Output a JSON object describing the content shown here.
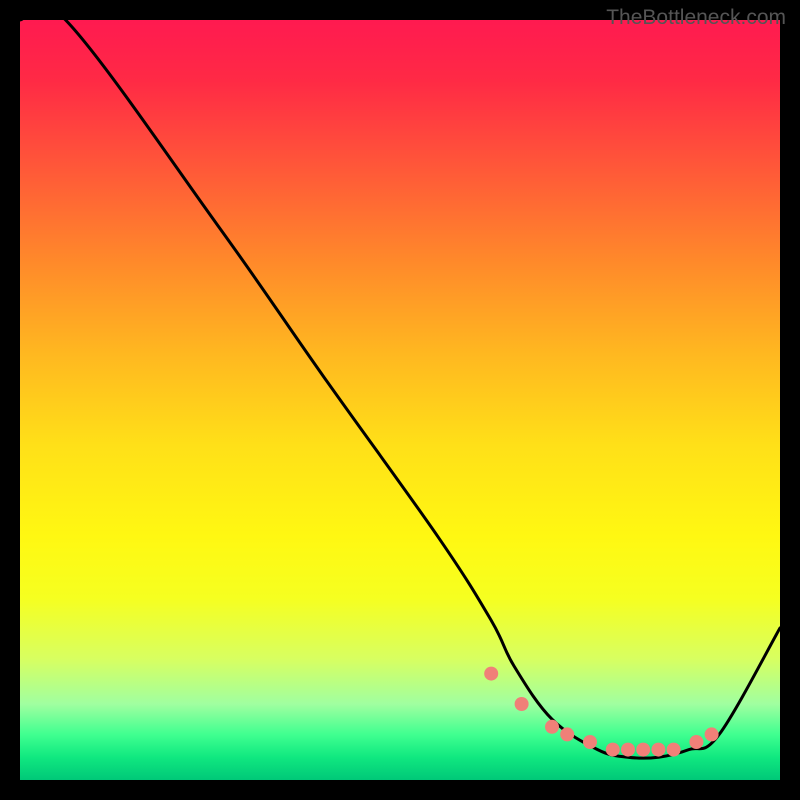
{
  "watermark": "TheBottleneck.com",
  "chart_data": {
    "type": "line",
    "title": "",
    "xlabel": "",
    "ylabel": "",
    "xlim": [
      0,
      100
    ],
    "ylim": [
      0,
      100
    ],
    "series": [
      {
        "name": "curve",
        "x": [
          0,
          6,
          26,
          40,
          55,
          62,
          65,
          70,
          76,
          80,
          84,
          88,
          92,
          100
        ],
        "values": [
          100,
          100,
          73,
          53,
          32,
          21,
          15,
          8,
          4,
          3,
          3,
          4,
          6,
          20
        ]
      }
    ],
    "markers": {
      "name": "highlight-points",
      "color": "#f08078",
      "x": [
        62,
        66,
        70,
        72,
        75,
        78,
        80,
        82,
        84,
        86,
        89,
        91
      ],
      "values": [
        14,
        10,
        7,
        6,
        5,
        4,
        4,
        4,
        4,
        4,
        5,
        6
      ]
    },
    "gradient_stops": [
      {
        "pos": 0,
        "color": "#ff1a50"
      },
      {
        "pos": 20,
        "color": "#ff5a38"
      },
      {
        "pos": 44,
        "color": "#ffb820"
      },
      {
        "pos": 68,
        "color": "#fff812"
      },
      {
        "pos": 90,
        "color": "#a0ffa0"
      },
      {
        "pos": 100,
        "color": "#00c878"
      }
    ]
  }
}
